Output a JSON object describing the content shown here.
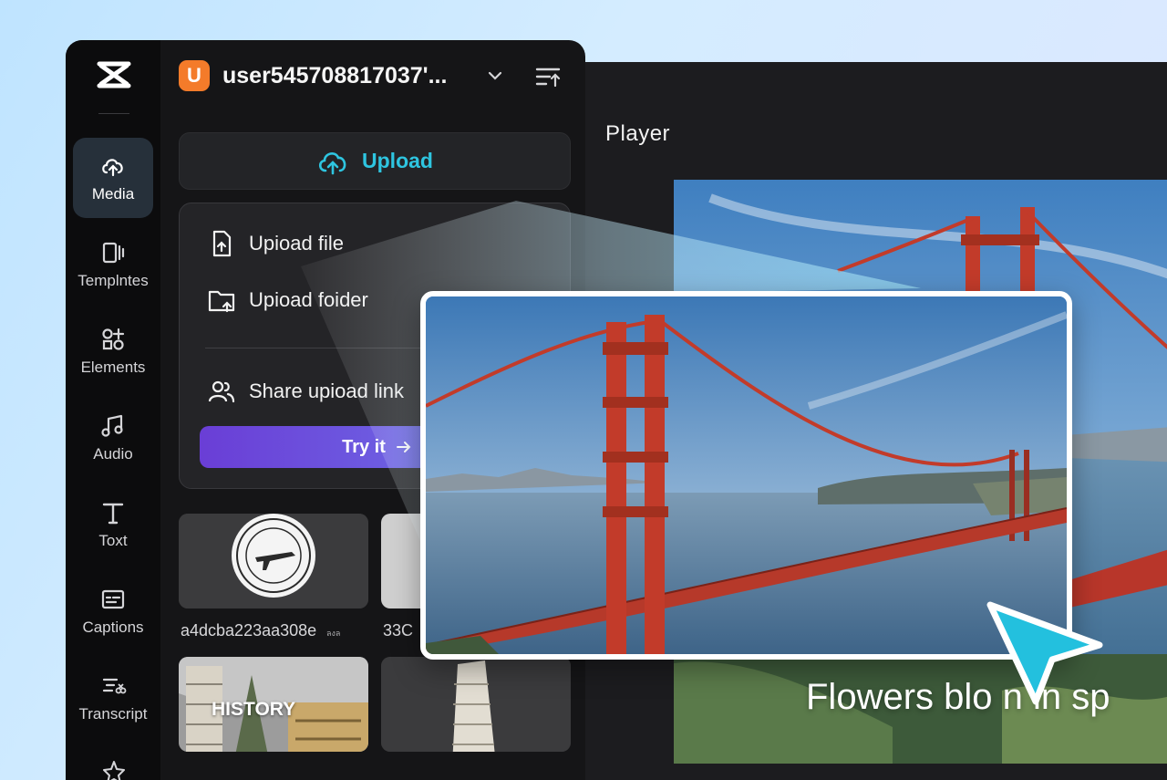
{
  "sidebar": {
    "items": [
      {
        "label": "Media",
        "icon": "cloud-media-icon",
        "active": true
      },
      {
        "label": "Templntes",
        "icon": "templates-icon"
      },
      {
        "label": "Elements",
        "icon": "elements-icon"
      },
      {
        "label": "Audio",
        "icon": "music-note-icon"
      },
      {
        "label": "Toxt",
        "icon": "text-icon"
      },
      {
        "label": "Captions",
        "icon": "captions-icon"
      },
      {
        "label": "Transcript",
        "icon": "transcript-icon"
      }
    ]
  },
  "header": {
    "avatar_letter": "U",
    "username": "user545708817037'...",
    "avatar_color": "#f47b2a"
  },
  "upload": {
    "label": "Upload",
    "accent_color": "#2ec5e0"
  },
  "upload_menu": {
    "upload_file": "Upioad file",
    "upload_folder": "Upioad foider",
    "share_link": "Share upioad link",
    "try_it": "Try it"
  },
  "media": {
    "tiles": [
      {
        "label": "a4dcba223aa308e",
        "suffix": "ลงล"
      },
      {
        "label": "33C"
      },
      {
        "overlay": "HISTORY"
      },
      {}
    ]
  },
  "player": {
    "title": "Player",
    "caption": "Flowers blo  n in sp"
  }
}
